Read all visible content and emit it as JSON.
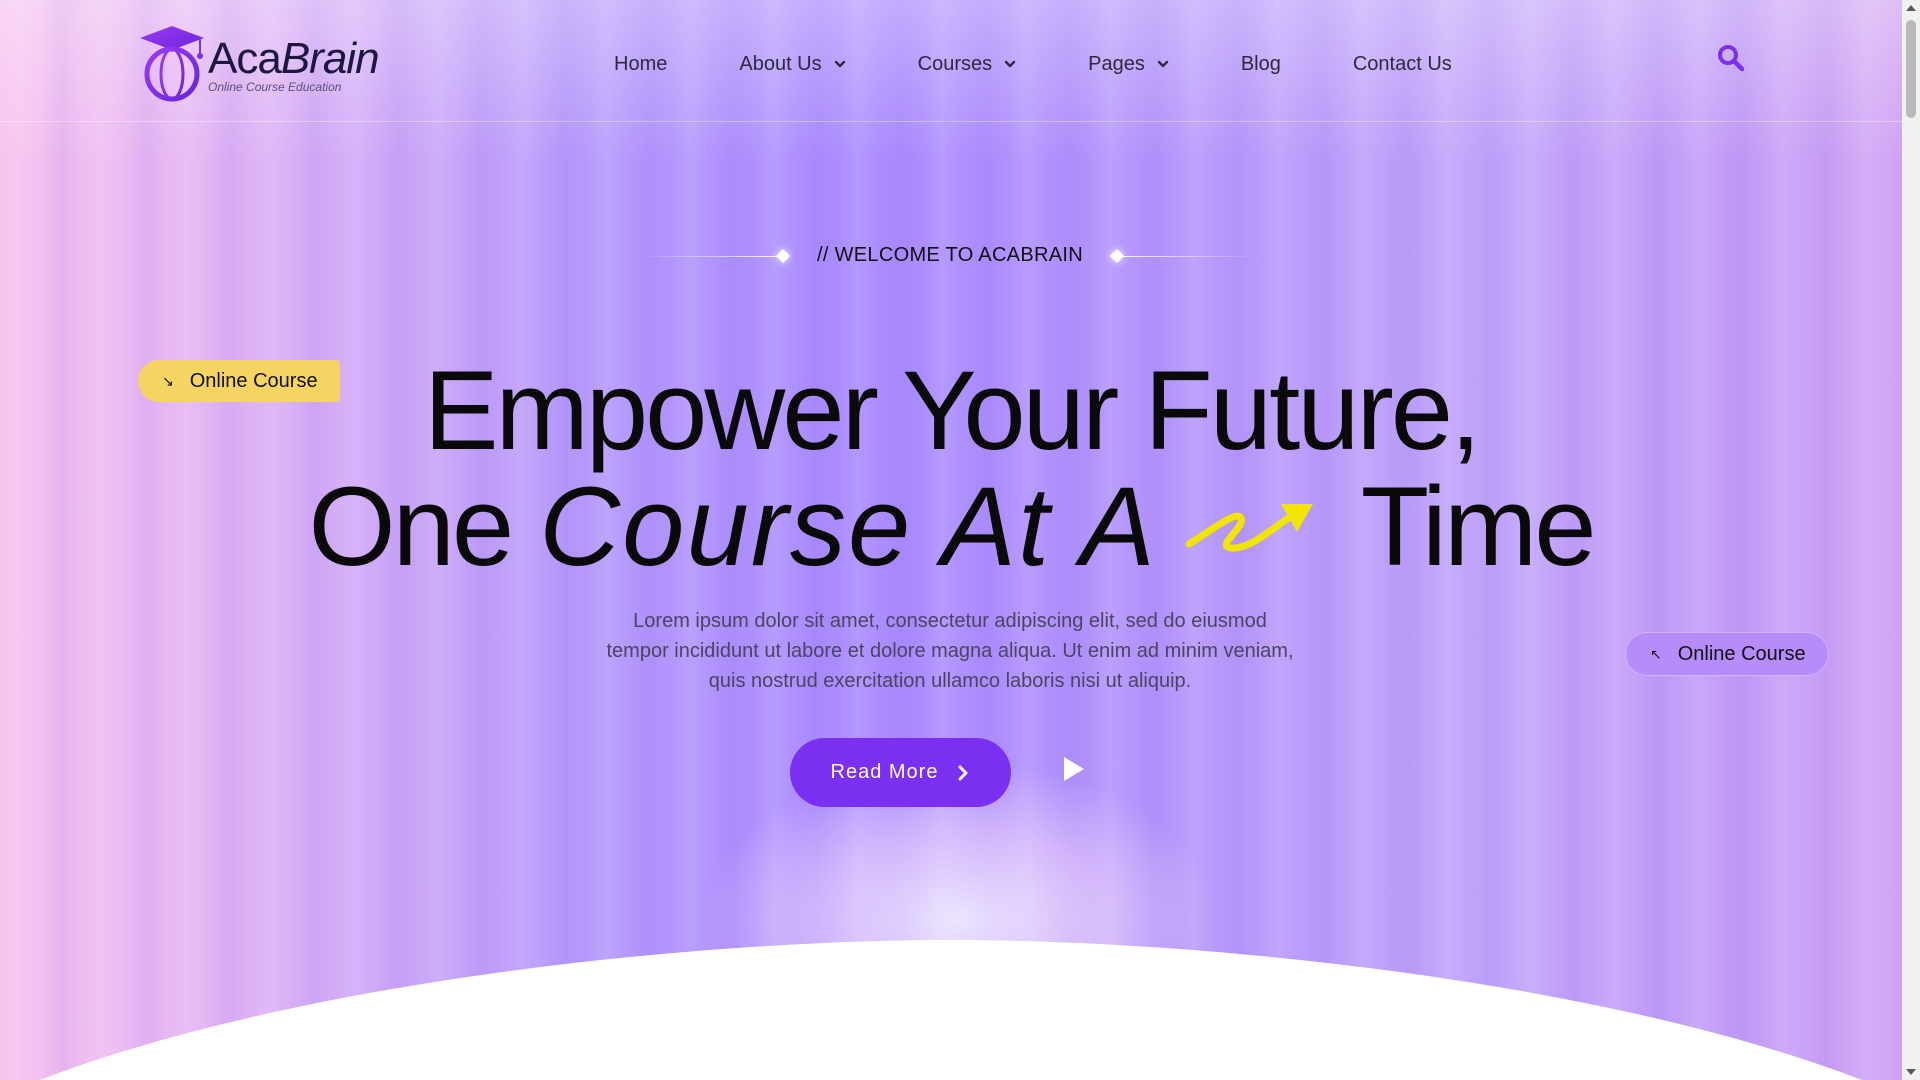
{
  "header": {
    "logo": {
      "name_part1": "Aca",
      "name_part2": "Brain",
      "tagline": "Online Course Education",
      "icon": "graduation-globe-icon"
    },
    "nav": [
      {
        "label": "Home",
        "has_dropdown": false
      },
      {
        "label": "About Us",
        "has_dropdown": true
      },
      {
        "label": "Courses",
        "has_dropdown": true
      },
      {
        "label": "Pages",
        "has_dropdown": true
      },
      {
        "label": "Blog",
        "has_dropdown": false
      },
      {
        "label": "Contact Us",
        "has_dropdown": false
      }
    ],
    "search_icon": "search-icon"
  },
  "hero": {
    "welcome": "// WELCOME TO ACABRAIN",
    "headline_line1": "Empower Your Future,",
    "headline_line2_a": "One",
    "headline_line2_italic": "Course At A",
    "headline_line2_b": "Time",
    "description": "Lorem ipsum dolor sit amet, consectetur adipiscing elit, sed do eiusmod tempor incididunt ut labore et dolore magna aliqua. Ut enim ad minim veniam, quis nostrud exercitation ullamco laboris nisi ut aliquip.",
    "read_more_label": "Read More",
    "badge_left": {
      "label": "Online Course",
      "arrow": "↘"
    },
    "badge_right": {
      "label": "Online Course",
      "arrow": "↖"
    }
  },
  "colors": {
    "accent": "#7b2ff0",
    "badge_yellow": "#f6d463",
    "badge_purple": "#b68cfb",
    "scribble": "#f2e600"
  }
}
